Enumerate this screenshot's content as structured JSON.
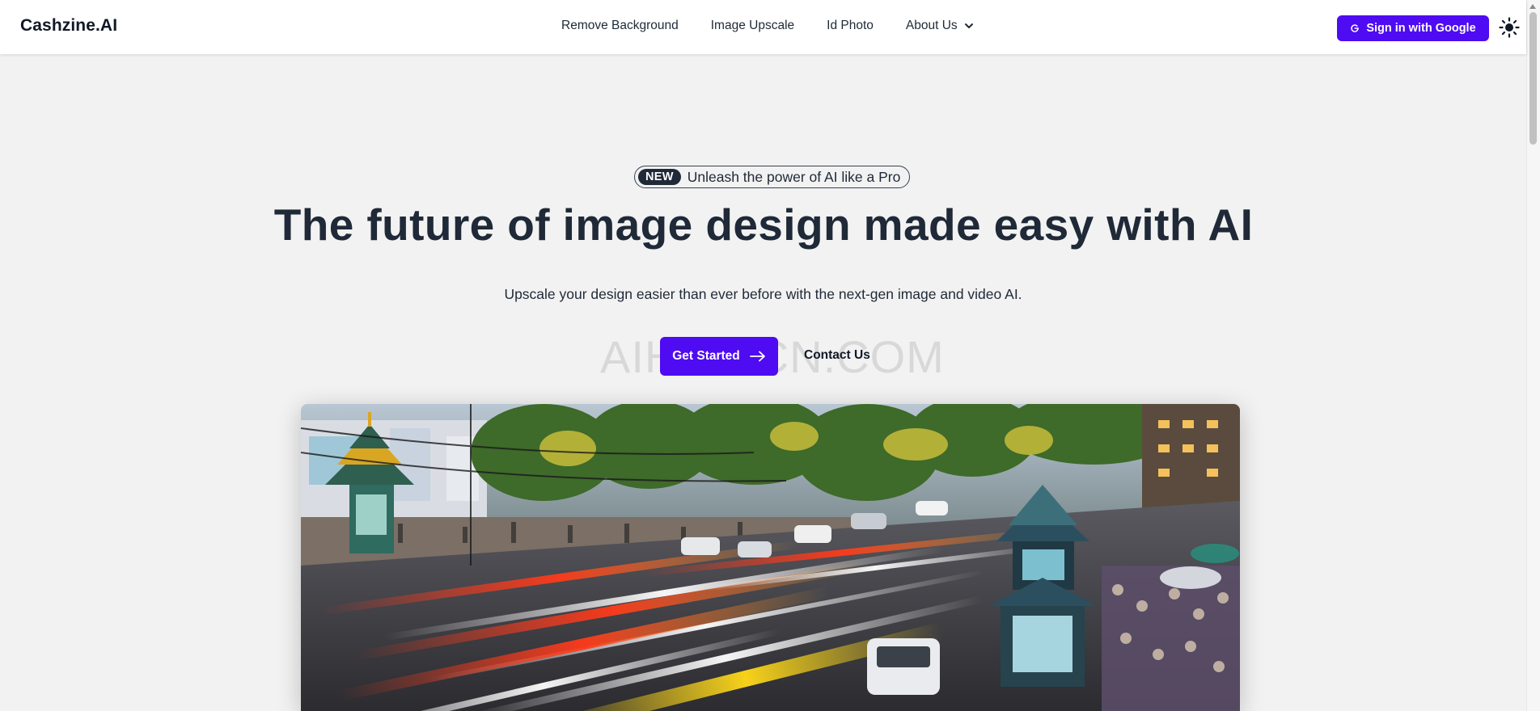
{
  "header": {
    "logo": "Cashzine.AI",
    "nav": [
      {
        "label": "Remove Background"
      },
      {
        "label": "Image Upscale"
      },
      {
        "label": "Id Photo"
      },
      {
        "label": "About Us"
      }
    ],
    "signin_label": "Sign in with Google"
  },
  "hero": {
    "badge_tag": "NEW",
    "badge_text": "Unleash the power of AI like a Pro",
    "headline": "The future of image design made easy with AI",
    "subline": "Upscale your design easier than ever before with the next-gen image and video AI.",
    "cta_label": "Get Started",
    "contact_label": "Contact Us",
    "watermark": "AIHUB.CN.COM"
  },
  "colors": {
    "accent": "#4f0bf2",
    "page_bg": "#f2f2f2",
    "text": "#1f2937"
  },
  "icons": {
    "about_chevron": "chevron-down-icon",
    "signin": "google-icon",
    "theme_toggle": "sun-icon",
    "cta": "arrow-right-icon"
  }
}
